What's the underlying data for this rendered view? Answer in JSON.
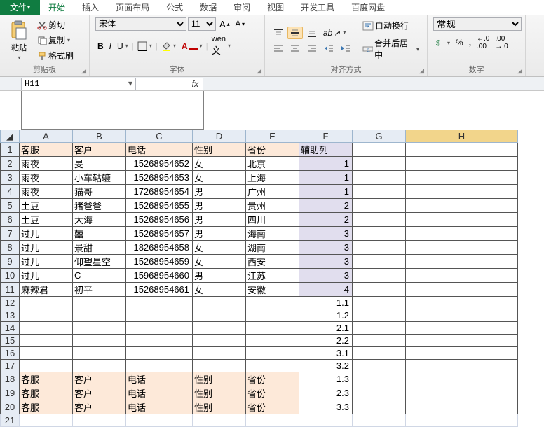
{
  "tabs": {
    "file": "文件",
    "home": "开始",
    "insert": "插入",
    "layout": "页面布局",
    "formula": "公式",
    "data": "数据",
    "review": "审阅",
    "view": "视图",
    "dev": "开发工具",
    "baidu": "百度网盘"
  },
  "clipboard": {
    "paste": "粘贴",
    "cut": "剪切",
    "copy": "复制",
    "format_painter": "格式刷",
    "group": "剪贴板"
  },
  "font": {
    "name": "宋体",
    "size": "11",
    "group": "字体"
  },
  "align": {
    "wrap": "自动换行",
    "merge": "合并后居中",
    "group": "对齐方式"
  },
  "number": {
    "format": "常规",
    "group": "数字"
  },
  "namebox": "H11",
  "fx": "fx",
  "cols": [
    "A",
    "B",
    "C",
    "D",
    "E",
    "F",
    "G",
    "H"
  ],
  "headers": {
    "a": "客服",
    "b": "客户",
    "c": "电话",
    "d": "性别",
    "e": "省份",
    "f": "辅助列"
  },
  "rows": [
    {
      "a": "雨夜",
      "b": "旻",
      "c": "15268954652",
      "d": "女",
      "e": "北京",
      "f": "1"
    },
    {
      "a": "雨夜",
      "b": "小车轱辘",
      "c": "15268954653",
      "d": "女",
      "e": "上海",
      "f": "1"
    },
    {
      "a": "雨夜",
      "b": "猫哥",
      "c": "17268954654",
      "d": "男",
      "e": "广州",
      "f": "1"
    },
    {
      "a": "土豆",
      "b": "猪爸爸",
      "c": "15268954655",
      "d": "男",
      "e": "贵州",
      "f": "2"
    },
    {
      "a": "土豆",
      "b": "大海",
      "c": "15268954656",
      "d": "男",
      "e": "四川",
      "f": "2"
    },
    {
      "a": "过儿",
      "b": "囍",
      "c": "15268954657",
      "d": "男",
      "e": "海南",
      "f": "3"
    },
    {
      "a": "过儿",
      "b": "景甜",
      "c": "18268954658",
      "d": "女",
      "e": "湖南",
      "f": "3"
    },
    {
      "a": "过儿",
      "b": "仰望星空",
      "c": "15268954659",
      "d": "女",
      "e": "西安",
      "f": "3"
    },
    {
      "a": "过儿",
      "b": "C",
      "c": "15968954660",
      "d": "男",
      "e": "江苏",
      "f": "3"
    },
    {
      "a": "麻辣君",
      "b": "初平",
      "c": "15268954661",
      "d": "女",
      "e": "安徽",
      "f": "4"
    }
  ],
  "extra_f": [
    "1.1",
    "1.2",
    "2.1",
    "2.2",
    "3.1",
    "3.2"
  ],
  "repeat_headers": [
    {
      "f": "1.3"
    },
    {
      "f": "2.3"
    },
    {
      "f": "3.3"
    }
  ],
  "chart_data": {
    "type": "table",
    "columns": [
      "客服",
      "客户",
      "电话",
      "性别",
      "省份",
      "辅助列"
    ],
    "data": [
      [
        "雨夜",
        "旻",
        15268954652,
        "女",
        "北京",
        1
      ],
      [
        "雨夜",
        "小车轱辘",
        15268954653,
        "女",
        "上海",
        1
      ],
      [
        "雨夜",
        "猫哥",
        17268954654,
        "男",
        "广州",
        1
      ],
      [
        "土豆",
        "猪爸爸",
        15268954655,
        "男",
        "贵州",
        2
      ],
      [
        "土豆",
        "大海",
        15268954656,
        "男",
        "四川",
        2
      ],
      [
        "过儿",
        "囍",
        15268954657,
        "男",
        "海南",
        3
      ],
      [
        "过儿",
        "景甜",
        18268954658,
        "女",
        "湖南",
        3
      ],
      [
        "过儿",
        "仰望星空",
        15268954659,
        "女",
        "西安",
        3
      ],
      [
        "过儿",
        "C",
        15968954660,
        "男",
        "江苏",
        3
      ],
      [
        "麻辣君",
        "初平",
        15268954661,
        "女",
        "安徽",
        4
      ]
    ]
  }
}
